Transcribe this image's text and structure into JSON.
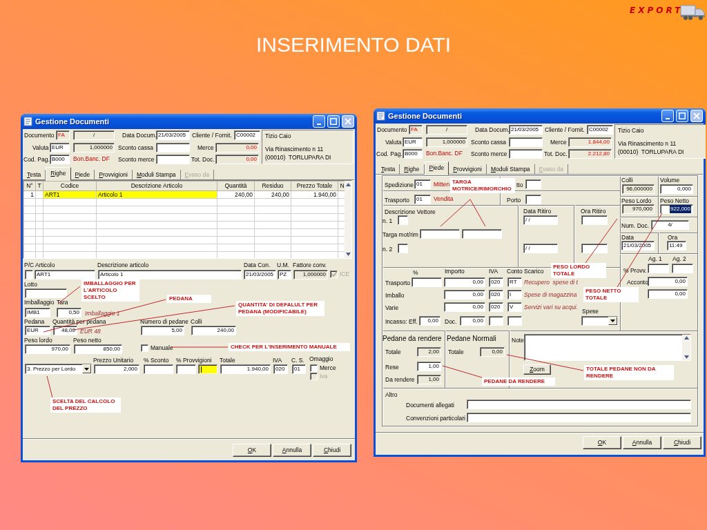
{
  "slide": {
    "title": "INSERIMENTO DATI",
    "logo_text": "EXPORT"
  },
  "windows": [
    {
      "title": "Gestione Documenti",
      "header": [
        {
          "kind": "label",
          "text": "Documento"
        },
        {
          "kind": "readonly-red",
          "value": "FA"
        },
        {
          "kind": "readonly",
          "value": "/"
        },
        {
          "kind": "label",
          "text": "Data Docum."
        },
        {
          "kind": "field",
          "value": "21/03/2005"
        },
        {
          "kind": "label",
          "text": "Cliente / Fornit."
        },
        {
          "kind": "field",
          "value": "C00002"
        },
        {
          "kind": "label",
          "text": "Valuta"
        },
        {
          "kind": "field",
          "value": "EUR"
        },
        {
          "kind": "readonly",
          "value": "1,000000"
        },
        {
          "kind": "label",
          "text": "Sconto cassa"
        },
        {
          "kind": "field"
        },
        {
          "kind": "label",
          "text": "Merce"
        },
        {
          "kind": "readonly-red",
          "value": "0,00"
        },
        {
          "kind": "label",
          "text": "Cod. Pag."
        },
        {
          "kind": "field",
          "value": "B000"
        },
        {
          "kind": "note",
          "text": "Bon.Banc. DF"
        },
        {
          "kind": "label",
          "text": "Sconto merce"
        },
        {
          "kind": "field"
        },
        {
          "kind": "label",
          "text": "Tot. Doc."
        },
        {
          "kind": "readonly-red",
          "value": "0,00"
        },
        {
          "kind": "address",
          "lines": [
            "Tizio Caio",
            "Via Rinascimento n 11",
            "(00010)  TORLUPARA DI"
          ]
        }
      ],
      "tabs": [
        {
          "label": "Testa",
          "selected": false,
          "disabled": false
        },
        {
          "label": "Righe",
          "selected": true,
          "disabled": false
        },
        {
          "label": "Piede",
          "selected": false,
          "disabled": false
        },
        {
          "label": "Provvigioni",
          "selected": false,
          "disabled": false
        },
        {
          "label": "Moduli Stampa",
          "selected": false,
          "disabled": false
        },
        {
          "label": "Evaso da",
          "selected": false,
          "disabled": true
        }
      ],
      "grid": {
        "columns": [
          "N°",
          "T",
          "Codice",
          "Descrizione Articolo",
          "Quantità",
          "Residuo",
          "Prezzo Totale",
          "N"
        ],
        "rows": [
          {
            "cells": [
              "1",
              null,
              "ART1",
              "Articolo 1",
              "240,00",
              "240,00",
              "1.940,00",
              null
            ],
            "selected": true
          }
        ]
      },
      "body": [
        {
          "kind": "label",
          "text": "P/C Articolo"
        },
        {
          "kind": "label",
          "text": "Descrizione articolo"
        },
        {
          "kind": "label",
          "text": "Data Con."
        },
        {
          "kind": "label",
          "text": "U.M."
        },
        {
          "kind": "label",
          "text": "Fattore conv."
        },
        {
          "kind": "field"
        },
        {
          "kind": "field",
          "value": "ART1"
        },
        {
          "kind": "field",
          "value": "Articolo 1"
        },
        {
          "kind": "field",
          "value": "21/03/2005"
        },
        {
          "kind": "field",
          "value": "PZ"
        },
        {
          "kind": "readonly",
          "value": "1,000000"
        },
        {
          "kind": "checkbox",
          "label": "ICE",
          "checked": true,
          "disabled": true
        },
        {
          "kind": "label",
          "text": "Lotto"
        },
        {
          "kind": "field"
        },
        {
          "kind": "label",
          "text": "Imballaggio"
        },
        {
          "kind": "label",
          "text": "Tara"
        },
        {
          "kind": "field",
          "value": "IMB1"
        },
        {
          "kind": "field",
          "value": "0,50"
        },
        {
          "kind": "italic",
          "text": "Imballaggio 1"
        },
        {
          "kind": "label",
          "text": "Pedana"
        },
        {
          "kind": "label",
          "text": "Quantità per pedana"
        },
        {
          "kind": "label",
          "text": "Numero di pedane"
        },
        {
          "kind": "label",
          "text": "Colli"
        },
        {
          "kind": "field",
          "value": "EUR"
        },
        {
          "kind": "field",
          "value": "48,00"
        },
        {
          "kind": "italic",
          "text": "EUR 48"
        },
        {
          "kind": "field",
          "value": "5,00"
        },
        {
          "kind": "field",
          "value": "240,00"
        },
        {
          "kind": "label",
          "text": "Peso lordo"
        },
        {
          "kind": "label",
          "text": "Peso netto"
        },
        {
          "kind": "field",
          "value": "970,00"
        },
        {
          "kind": "field",
          "value": "850,00"
        },
        {
          "kind": "checkbox",
          "label": "Manuale",
          "checked": false,
          "disabled": false
        },
        {
          "kind": "label",
          "text": "Prezzo Unitario"
        },
        {
          "kind": "label",
          "text": "% Sconto"
        },
        {
          "kind": "label",
          "text": "% Provvigioni"
        },
        {
          "kind": "label",
          "text": "Totale"
        },
        {
          "kind": "label",
          "text": "IVA"
        },
        {
          "kind": "label",
          "text": "C. S."
        },
        {
          "kind": "label",
          "text": "Omaggio"
        },
        {
          "kind": "combo",
          "value": "3. Prezzo per Lordo"
        },
        {
          "kind": "field",
          "value": "2,000"
        },
        {
          "kind": "field"
        },
        {
          "kind": "field"
        },
        {
          "kind": "field-active"
        },
        {
          "kind": "field",
          "value": "1.940,00"
        },
        {
          "kind": "field",
          "value": "020"
        },
        {
          "kind": "field",
          "value": "01"
        },
        {
          "kind": "checkbox",
          "label": "Merce",
          "checked": false,
          "disabled": false
        },
        {
          "kind": "checkbox",
          "label": "Iva",
          "checked": false,
          "disabled": true
        }
      ],
      "buttons": [
        "OK",
        "Annulla",
        "Chiudi"
      ]
    },
    {
      "title": "Gestione Documenti",
      "header": [
        {
          "kind": "label",
          "text": "Documento"
        },
        {
          "kind": "readonly-red",
          "value": "FA"
        },
        {
          "kind": "readonly",
          "value": "/"
        },
        {
          "kind": "label",
          "text": "Data Docum."
        },
        {
          "kind": "field",
          "value": "21/03/2005"
        },
        {
          "kind": "label",
          "text": "Cliente / Fornit."
        },
        {
          "kind": "field",
          "value": "C00002"
        },
        {
          "kind": "label",
          "text": "Valuta"
        },
        {
          "kind": "field",
          "value": "EUR"
        },
        {
          "kind": "readonly",
          "value": "1,000000"
        },
        {
          "kind": "label",
          "text": "Sconto cassa"
        },
        {
          "kind": "field"
        },
        {
          "kind": "label",
          "text": "Merce"
        },
        {
          "kind": "readonly-red",
          "value": "1.844,00"
        },
        {
          "kind": "label",
          "text": "Cod. Pag."
        },
        {
          "kind": "field",
          "value": "B000"
        },
        {
          "kind": "note",
          "text": "Bon.Banc. DF"
        },
        {
          "kind": "label",
          "text": "Sconto merce"
        },
        {
          "kind": "field"
        },
        {
          "kind": "label",
          "text": "Tot. Doc."
        },
        {
          "kind": "readonly-red",
          "value": "2.212,80"
        },
        {
          "kind": "address",
          "lines": [
            "Tizio Caio",
            "Via Rinascimento n 11",
            "(00010)  TORLUPARA DI"
          ]
        }
      ],
      "tabs": [
        {
          "label": "Testa",
          "selected": false,
          "disabled": false
        },
        {
          "label": "Righe",
          "selected": false,
          "disabled": false
        },
        {
          "label": "Piede",
          "selected": true,
          "disabled": false
        },
        {
          "label": "Provvigioni",
          "selected": false,
          "disabled": false
        },
        {
          "label": "Moduli Stampa",
          "selected": false,
          "disabled": false
        },
        {
          "label": "Evaso da",
          "selected": false,
          "disabled": true
        }
      ],
      "body": [
        {
          "kind": "label",
          "text": "Spedizione"
        },
        {
          "kind": "field",
          "value": "01"
        },
        {
          "kind": "note",
          "text": "Mitten"
        },
        {
          "kind": "label",
          "text": "tto"
        },
        {
          "kind": "field"
        },
        {
          "kind": "label",
          "text": "Trasporto"
        },
        {
          "kind": "field",
          "value": "01"
        },
        {
          "kind": "note",
          "text": "Vendita"
        },
        {
          "kind": "label",
          "text": "Porto"
        },
        {
          "kind": "field"
        },
        {
          "kind": "label",
          "text": "Descrizione Vettore"
        },
        {
          "kind": "label",
          "text": "n. 1"
        },
        {
          "kind": "field"
        },
        {
          "kind": "label",
          "text": "Targa mot/rim"
        },
        {
          "kind": "field"
        },
        {
          "kind": "field"
        },
        {
          "kind": "label",
          "text": "n. 2"
        },
        {
          "kind": "field"
        },
        {
          "kind": "label",
          "text": "Data Ritiro"
        },
        {
          "kind": "field",
          "value": "/ /"
        },
        {
          "kind": "field",
          "value": "/ /"
        },
        {
          "kind": "label",
          "text": "Ora Ritiro"
        },
        {
          "kind": "field"
        },
        {
          "kind": "field"
        },
        {
          "kind": "label",
          "text": "Colli"
        },
        {
          "kind": "readonly",
          "value": "96,000000"
        },
        {
          "kind": "label",
          "text": "Volume"
        },
        {
          "kind": "field",
          "value": "0,000"
        },
        {
          "kind": "label",
          "text": "Peso Lordo"
        },
        {
          "kind": "readonly",
          "value": "970,000"
        },
        {
          "kind": "label",
          "text": "Peso Netto"
        },
        {
          "kind": "field-selected",
          "value": "922,000"
        },
        {
          "kind": "label",
          "text": "Num. Doc."
        },
        {
          "kind": "field",
          "value": "4/"
        },
        {
          "kind": "label",
          "text": "Data"
        },
        {
          "kind": "label",
          "text": "Ora"
        },
        {
          "kind": "field",
          "value": "21/03/2005"
        },
        {
          "kind": "field",
          "value": "11:49"
        },
        {
          "kind": "label",
          "text": "Ag. 1"
        },
        {
          "kind": "label",
          "text": "Ag. 2"
        },
        {
          "kind": "label",
          "text": "% Provv."
        },
        {
          "kind": "field"
        },
        {
          "kind": "field"
        },
        {
          "kind": "label",
          "text": "Acconto"
        },
        {
          "kind": "field",
          "value": "0,00"
        },
        {
          "kind": "field",
          "value": "0,00"
        },
        {
          "kind": "label",
          "text": "%"
        },
        {
          "kind": "label",
          "text": "Importo"
        },
        {
          "kind": "label",
          "text": "IVA"
        },
        {
          "kind": "label",
          "text": "Conto Scarico"
        },
        {
          "kind": "label",
          "text": "Trasporto"
        },
        {
          "kind": "field"
        },
        {
          "kind": "field",
          "value": "0,00"
        },
        {
          "kind": "field",
          "value": "020"
        },
        {
          "kind": "field",
          "value": "RT"
        },
        {
          "kind": "italic",
          "text": "Recupero  spese di t"
        },
        {
          "kind": "label",
          "text": "Imballo"
        },
        {
          "kind": "field",
          "value": "0,00"
        },
        {
          "kind": "field",
          "value": "020"
        },
        {
          "kind": "field",
          "value": "I"
        },
        {
          "kind": "italic",
          "text": "Spese di magazzina"
        },
        {
          "kind": "label",
          "text": "Varie"
        },
        {
          "kind": "field",
          "value": "0,00"
        },
        {
          "kind": "field",
          "value": "020"
        },
        {
          "kind": "field",
          "value": "V"
        },
        {
          "kind": "italic",
          "text": "Servizi vari su acqui."
        },
        {
          "kind": "label",
          "text": "Spese"
        },
        {
          "kind": "combo"
        },
        {
          "kind": "label",
          "text": "Incasso: Eff."
        },
        {
          "kind": "field",
          "value": "0,00"
        },
        {
          "kind": "label",
          "text": "Doc."
        },
        {
          "kind": "field",
          "value": "0,00"
        },
        {
          "kind": "field"
        },
        {
          "kind": "field"
        },
        {
          "kind": "heading",
          "text": "Pedane da rendere"
        },
        {
          "kind": "heading",
          "text": "Pedane Normali"
        },
        {
          "kind": "label",
          "text": "Totale"
        },
        {
          "kind": "readonly",
          "value": "2,00"
        },
        {
          "kind": "label",
          "text": "Totale"
        },
        {
          "kind": "readonly",
          "value": "0,00"
        },
        {
          "kind": "label",
          "text": "Rese"
        },
        {
          "kind": "field",
          "value": "1,00"
        },
        {
          "kind": "label",
          "text": "Da rendere"
        },
        {
          "kind": "readonly",
          "value": "1,00"
        },
        {
          "kind": "label",
          "text": "Note"
        },
        {
          "kind": "textarea"
        },
        {
          "kind": "button",
          "label": "Zoom"
        },
        {
          "kind": "label",
          "text": "Altro"
        },
        {
          "kind": "label",
          "text": "Documenti allegati"
        },
        {
          "kind": "field"
        },
        {
          "kind": "label",
          "text": "Convenzioni particolari"
        },
        {
          "kind": "field"
        }
      ],
      "buttons": [
        "OK",
        "Annulla",
        "Chiudi"
      ]
    }
  ],
  "annotations": [
    {
      "text": "IMBALLAGGIO PER L'ARTICOLO SCELTO"
    },
    {
      "text": "PEDANA"
    },
    {
      "text": "QUANTITA' DI DEFALULT PER PEDANA (MODIFICABILE)"
    },
    {
      "text": "CHECK PER L'INSERIMENTO MANUALE"
    },
    {
      "text": "SCELTA DEL CALCOLO DEL PREZZO"
    },
    {
      "text": "TARGA MOTRICE/RIMORCHIO"
    },
    {
      "text": "PESO LORDO TOTALE"
    },
    {
      "text": "PESO NETTO TOTALE"
    },
    {
      "text": "TOTALE PEDANE NON DA RENDERE"
    },
    {
      "text": "PEDANE DA RENDERE"
    }
  ]
}
